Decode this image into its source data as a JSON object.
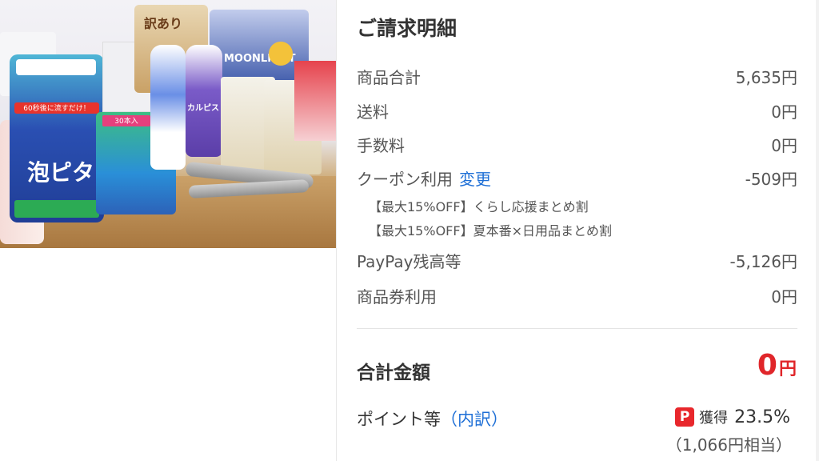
{
  "photo": {
    "products": [
      {
        "name": "toilet-cleaner-bag",
        "text": "泡ピタ"
      },
      {
        "name": "bath-cleaner-tag",
        "text": "60秒後に流すだけ！"
      },
      {
        "name": "snack-bag-1",
        "text": "訳あり"
      },
      {
        "name": "snack-bag-2",
        "text": "MOONLIGHT"
      },
      {
        "name": "drink-bottle",
        "text": "カルピス"
      },
      {
        "name": "blue-bag-label",
        "text": "30本入"
      }
    ]
  },
  "billing": {
    "title": "ご請求明細",
    "rows": [
      {
        "label": "商品合計",
        "value": "5,635円"
      },
      {
        "label": "送料",
        "value": "0円"
      },
      {
        "label": "手数料",
        "value": "0円"
      },
      {
        "label": "クーポン利用",
        "link": "変更",
        "value": "-509円"
      },
      {
        "label": "PayPay残高等",
        "value": "-5,126円"
      },
      {
        "label": "商品券利用",
        "value": "0円"
      }
    ],
    "coupons": [
      "【最大15%OFF】くらし応援まとめ割",
      "【最大15%OFF】夏本番×日用品まとめ割"
    ],
    "total": {
      "label": "合計金額",
      "value": "0",
      "unit": "円"
    },
    "points": {
      "label": "ポイント等",
      "link_open": "（",
      "link": "内訳",
      "link_close": "）",
      "icon": "P",
      "earn": "獲得",
      "rate": "23.5%",
      "equiv": "（1,066円相当）"
    }
  }
}
